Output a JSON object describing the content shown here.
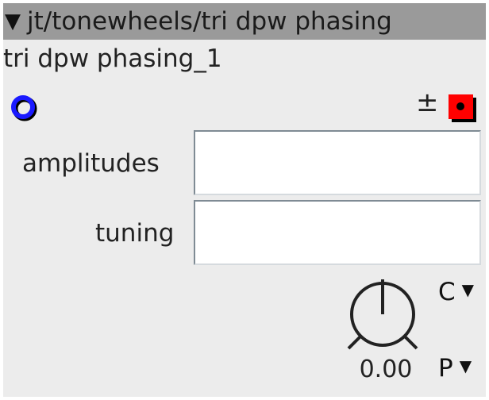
{
  "header": {
    "collapse_glyph": "▼",
    "path_title": "jt/tonewheels/tri dpw phasing"
  },
  "node": {
    "name": "tri dpw phasing_1"
  },
  "ports": {
    "input_icon": "input-port-icon",
    "output_icon": "output-port-icon",
    "input_color": "#1a1aff",
    "output_color": "#ff0000"
  },
  "controls": {
    "plus_minus": "±",
    "amplitudes": {
      "label": "amplitudes",
      "value": ""
    },
    "tuning": {
      "label": "tuning",
      "value": ""
    },
    "knob_value": "0.00",
    "dropdown_c": {
      "value": "C",
      "arrow": "▼"
    },
    "dropdown_p": {
      "value": "P",
      "arrow": "▼"
    }
  }
}
